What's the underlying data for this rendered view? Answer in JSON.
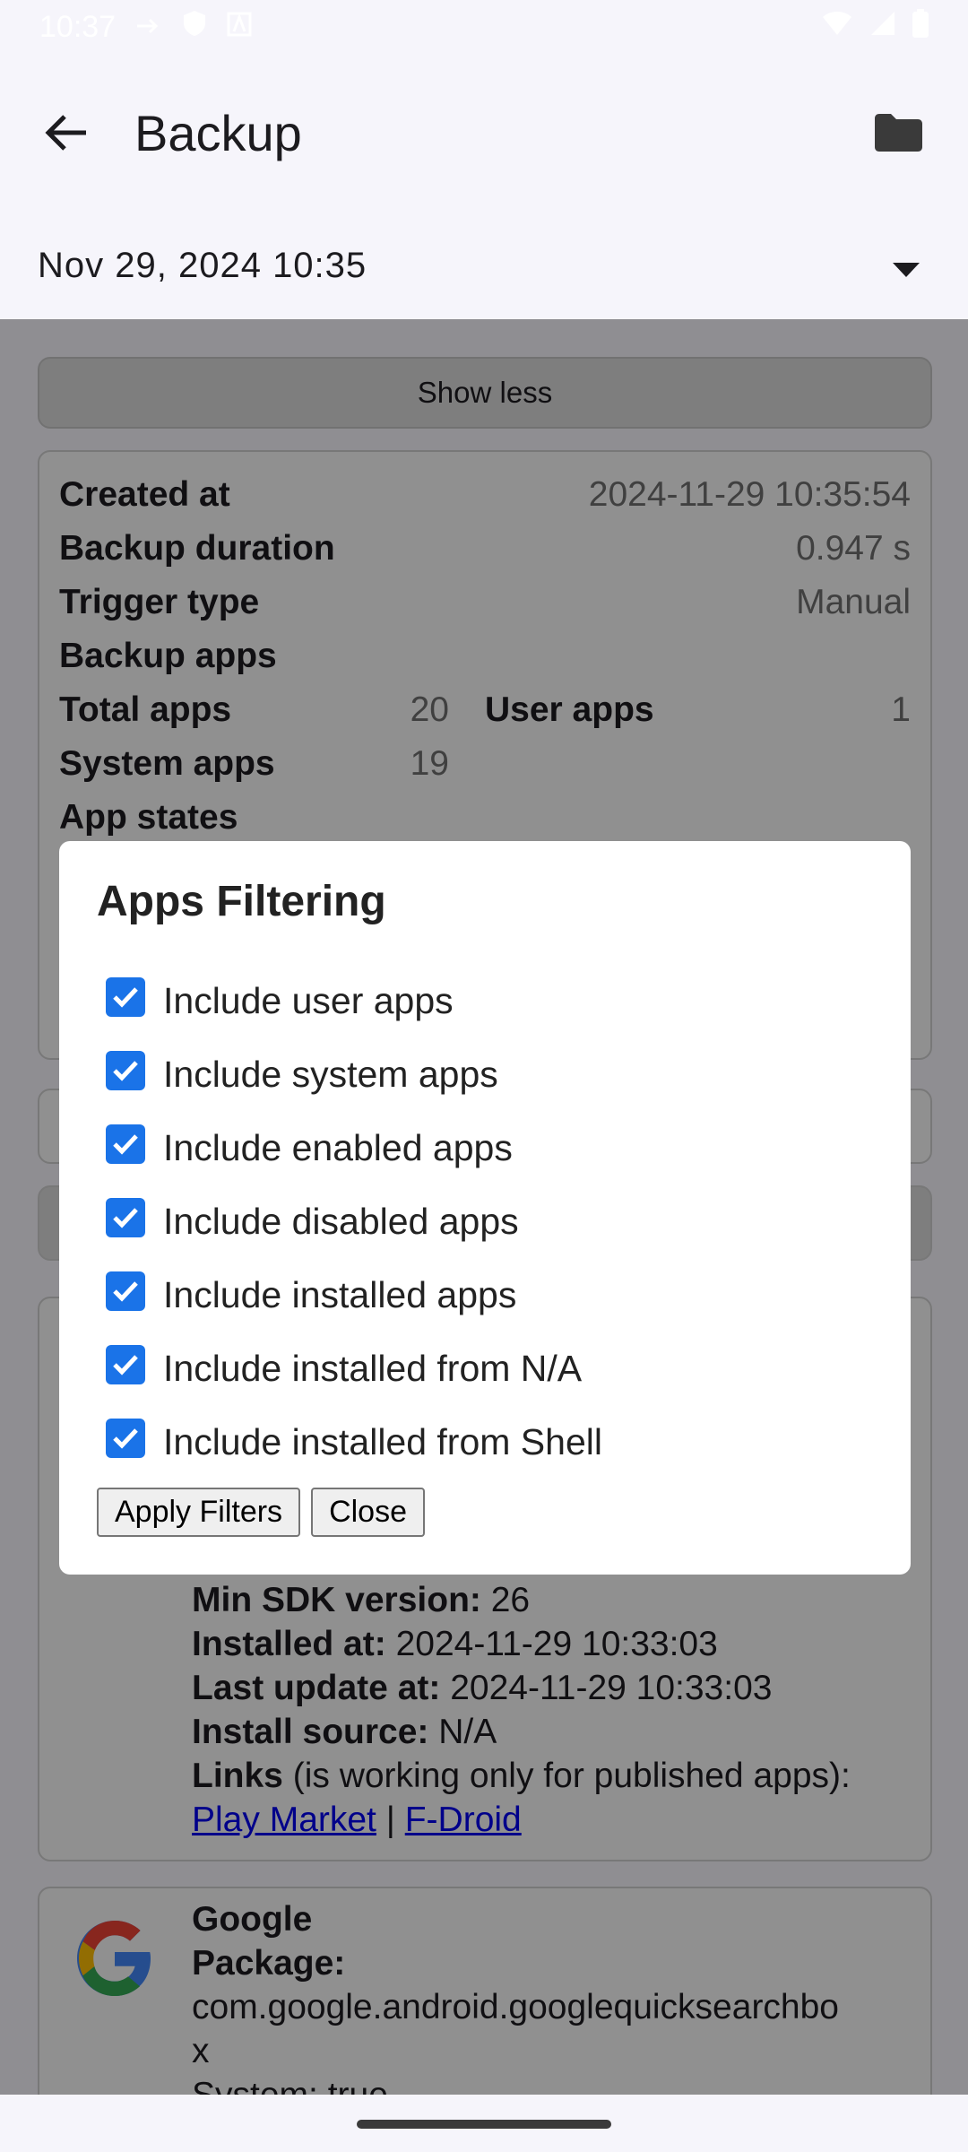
{
  "status_bar": {
    "time": "10:37"
  },
  "app_bar": {
    "title": "Backup"
  },
  "date_selector": {
    "value": "Nov 29, 2024 10:35"
  },
  "background": {
    "show_less_label": "Show less",
    "info": {
      "created_at_label": "Created at",
      "created_at_value": "2024-11-29 10:35:54",
      "duration_label": "Backup duration",
      "duration_value": "0.947 s",
      "trigger_label": "Trigger type",
      "trigger_value": "Manual",
      "backup_apps_label": "Backup apps",
      "total_apps_label": "Total apps",
      "total_apps_value": "20",
      "user_apps_label": "User apps",
      "user_apps_value": "1",
      "system_apps_label": "System apps",
      "system_apps_value": "19",
      "app_states_label": "App states"
    },
    "app_card": {
      "min_sdk_label": "Min SDK version:",
      "min_sdk_value": "26",
      "installed_at_label": "Installed at:",
      "installed_at_value": "2024-11-29 10:33:03",
      "last_update_label": "Last update at:",
      "last_update_value": "2024-11-29 10:33:03",
      "install_source_label": "Install source:",
      "install_source_value": "N/A",
      "links_label": "Links",
      "links_note": "(is working only for published apps):",
      "play_market": "Play Market",
      "separator": "|",
      "fdroid": "F-Droid"
    },
    "app_card2": {
      "name": "Google",
      "package_label": "Package:",
      "package_value": "com.google.android.googlequicksearchbo",
      "package_wrap": "x",
      "system_partial": "System: true"
    }
  },
  "dialog": {
    "title": "Apps Filtering",
    "options": [
      {
        "label": "Include user apps",
        "checked": true
      },
      {
        "label": "Include system apps",
        "checked": true
      },
      {
        "label": "Include enabled apps",
        "checked": true
      },
      {
        "label": "Include disabled apps",
        "checked": true
      },
      {
        "label": "Include installed apps",
        "checked": true
      },
      {
        "label": "Include installed from N/A",
        "checked": true
      },
      {
        "label": "Include installed from Shell",
        "checked": true
      }
    ],
    "apply_label": "Apply Filters",
    "close_label": "Close"
  },
  "colors": {
    "checkbox": "#1a73e8",
    "scrim": "rgba(0,0,0,0.42)",
    "link": "#0000ee"
  }
}
